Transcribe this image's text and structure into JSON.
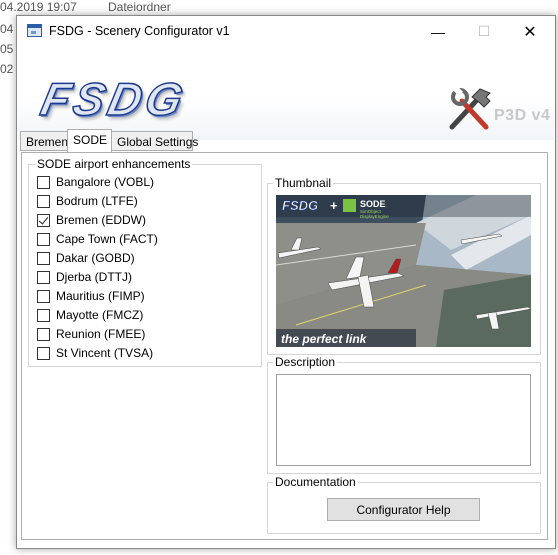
{
  "background": {
    "row1_date": "04.2019 19:07",
    "row1_type": "Dateiordner",
    "frag2": "04",
    "frag3": "05",
    "frag4": "02"
  },
  "window": {
    "title": "FSDG - Scenery Configurator v1",
    "minimize_glyph": "—",
    "maximize_glyph": "☐",
    "close_glyph": "✕"
  },
  "banner": {
    "logo_text": "FSDG",
    "platform_text": "P3D v4"
  },
  "tabs": [
    {
      "label": "Bremen"
    },
    {
      "label": "SODE"
    },
    {
      "label": "Global Settings"
    }
  ],
  "active_tab": "SODE",
  "sode_group": {
    "title": "SODE airport enhancements",
    "airports": [
      {
        "label": "Bangalore (VOBL)",
        "checked": false
      },
      {
        "label": "Bodrum (LTFE)",
        "checked": false
      },
      {
        "label": "Bremen (EDDW)",
        "checked": true
      },
      {
        "label": "Cape Town (FACT)",
        "checked": false
      },
      {
        "label": "Dakar (GOBD)",
        "checked": false
      },
      {
        "label": "Djerba (DTTJ)",
        "checked": false
      },
      {
        "label": "Mauritius (FIMP)",
        "checked": false
      },
      {
        "label": "Mayotte (FMCZ)",
        "checked": false
      },
      {
        "label": "Reunion (FMEE)",
        "checked": false
      },
      {
        "label": "St Vincent (TVSA)",
        "checked": false
      }
    ]
  },
  "thumbnail": {
    "title": "Thumbnail",
    "logo_text": "FSDG",
    "plus": "+",
    "sode_title": "SODE",
    "sode_subtitle1": "SimObject",
    "sode_subtitle2": "DisplayEngine",
    "caption": "the perfect link"
  },
  "description": {
    "title": "Description",
    "text": ""
  },
  "documentation": {
    "title": "Documentation",
    "button_label": "Configurator Help"
  },
  "colors": {
    "accent": "#1c3a8c",
    "sode_green": "#7cc242"
  }
}
